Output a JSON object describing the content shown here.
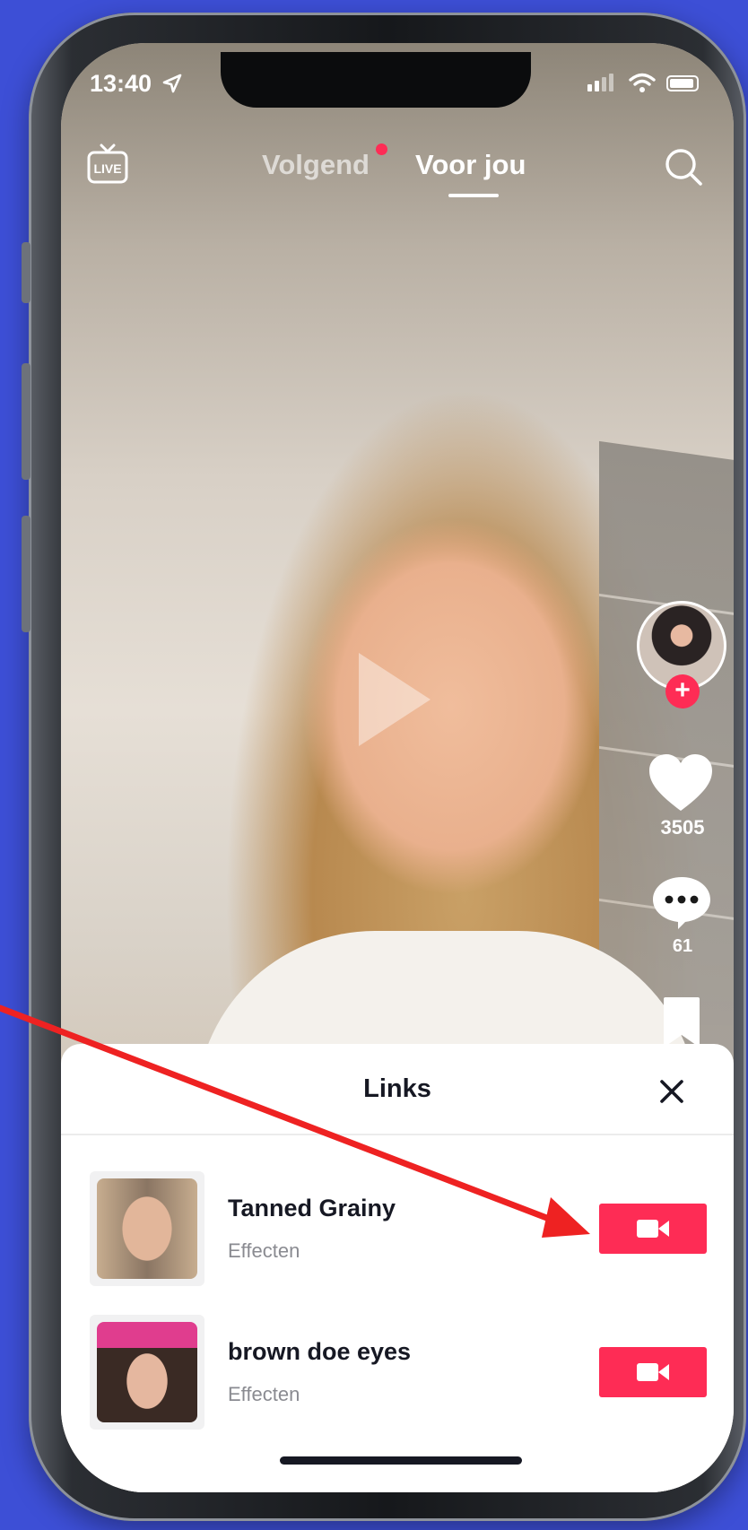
{
  "status_bar": {
    "time": "13:40"
  },
  "top_nav": {
    "tabs": [
      {
        "label": "Volgend",
        "active": false,
        "has_dot": true
      },
      {
        "label": "Voor jou",
        "active": true
      }
    ]
  },
  "rail": {
    "like_count": "3505",
    "comment_count": "61"
  },
  "sheet": {
    "title": "Links",
    "items": [
      {
        "name": "Tanned Grainy",
        "type": "Effecten"
      },
      {
        "name": "brown doe eyes",
        "type": "Effecten"
      }
    ]
  },
  "colors": {
    "background": "#3d4fd6",
    "accent": "#fe2c55",
    "annotation_arrow": "#ee2222"
  },
  "icons": [
    "live-icon",
    "search-icon",
    "play-icon",
    "heart-icon",
    "comment-icon",
    "bookmark-icon",
    "close-icon",
    "video-camera-icon",
    "location-arrow-icon",
    "wifi-icon",
    "battery-icon"
  ]
}
